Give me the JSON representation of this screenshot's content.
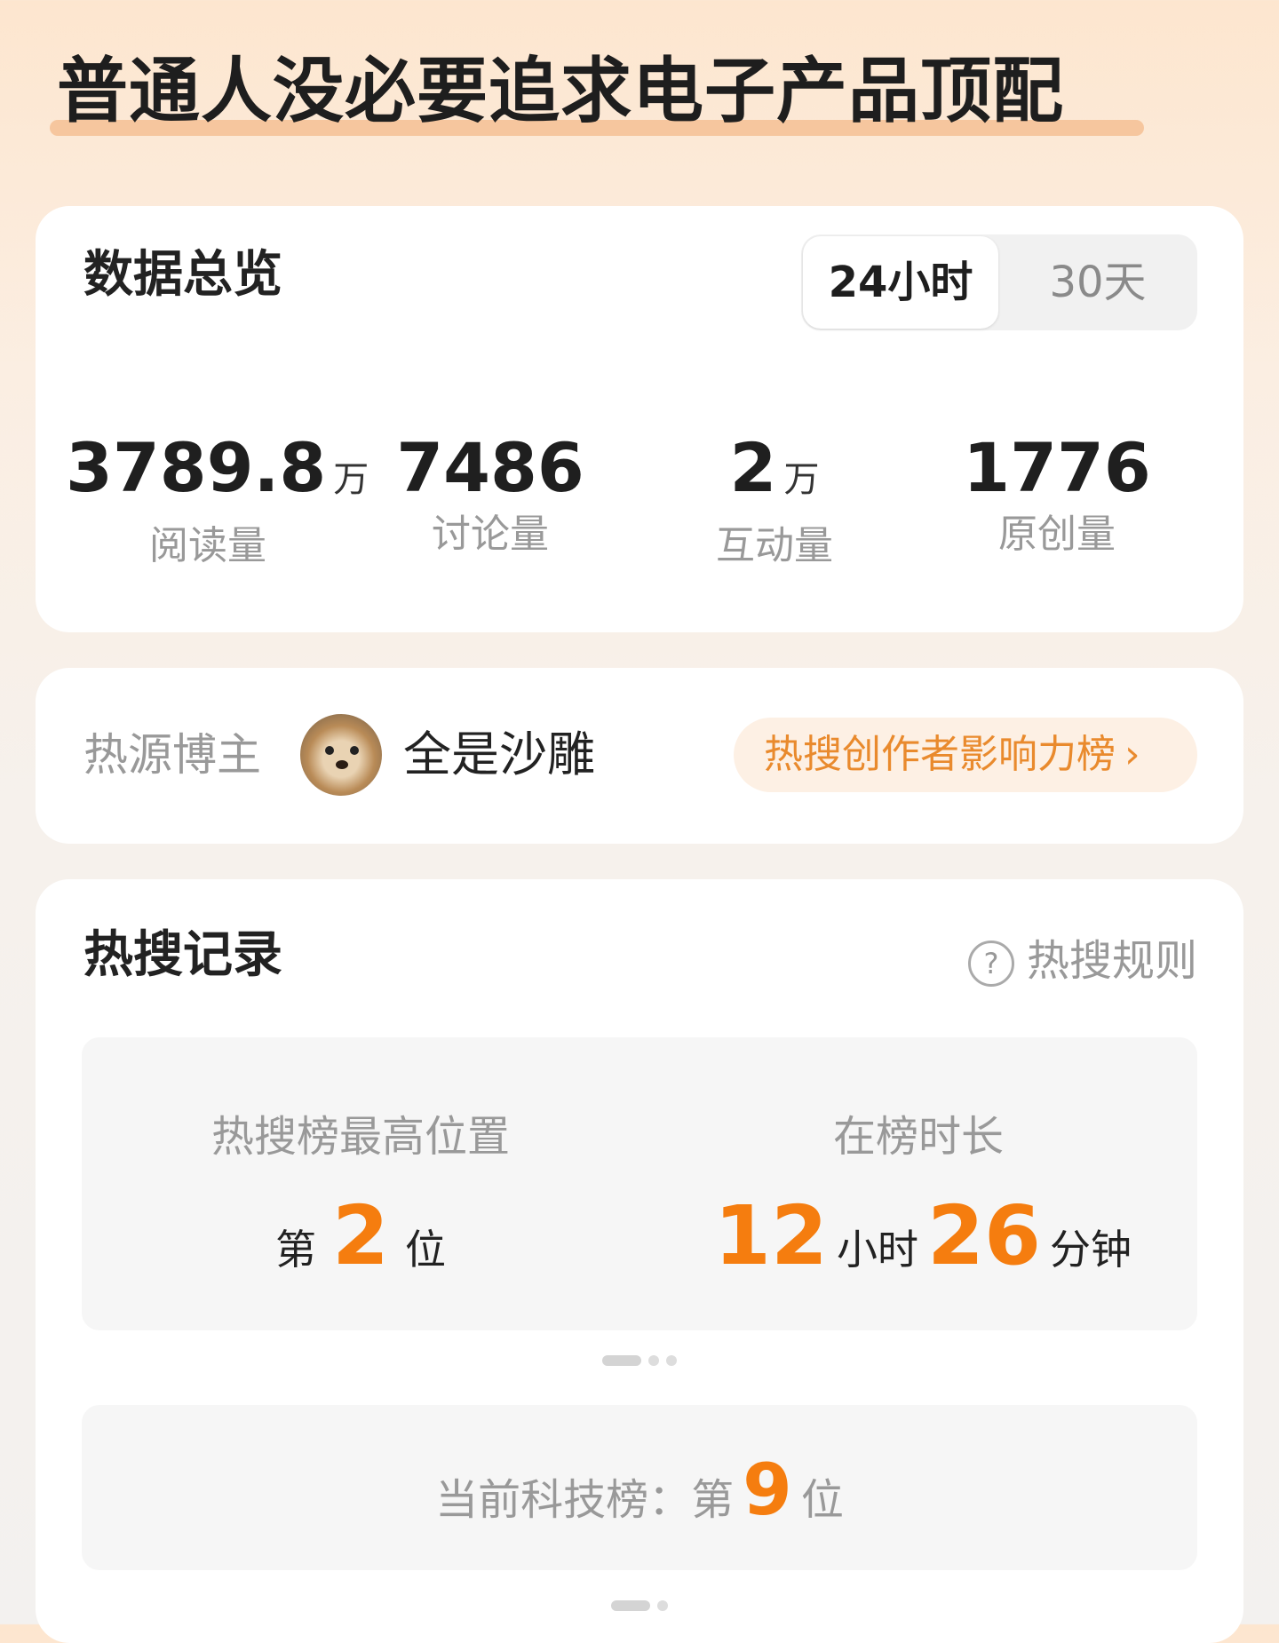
{
  "topic": {
    "title": "普通人没必要追求电子产品顶配"
  },
  "overview": {
    "title": "数据总览",
    "tabs": {
      "active": "24小时",
      "inactive": "30天"
    },
    "stats": [
      {
        "value": "3789.8",
        "unit": "万",
        "label": "阅读量"
      },
      {
        "value": "7486",
        "unit": "",
        "label": "讨论量"
      },
      {
        "value": "2",
        "unit": "万",
        "label": "互动量"
      },
      {
        "value": "1776",
        "unit": "",
        "label": "原创量"
      }
    ]
  },
  "blogger": {
    "label": "热源博主",
    "name": "全是沙雕",
    "influence_link": "热搜创作者影响力榜",
    "chevron": "›"
  },
  "record": {
    "title": "热搜记录",
    "rules_link": "热搜规则",
    "help_icon": "?",
    "highest": {
      "label": "热搜榜最高位置",
      "prefix": "第",
      "value": "2",
      "suffix": "位"
    },
    "duration": {
      "label": "在榜时长",
      "hours": "12",
      "hours_unit": "小时",
      "minutes": "26",
      "minutes_unit": "分钟"
    },
    "tech": {
      "label": "当前科技榜：",
      "prefix": "第",
      "value": "9",
      "suffix": "位"
    }
  },
  "colors": {
    "accent": "#f57d0f",
    "link": "#e98a2d",
    "highlight": "#f6c69e"
  }
}
